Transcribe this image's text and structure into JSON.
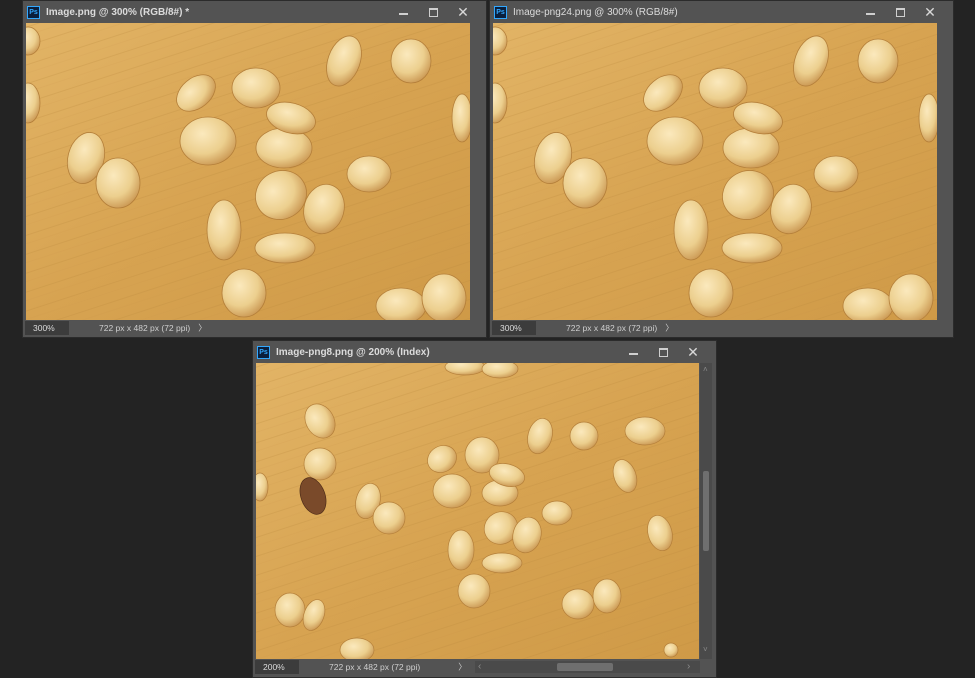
{
  "windows": [
    {
      "title": "Image.png @ 300% (RGB/8#) *",
      "zoom": "300%",
      "doc_info": "722 px x 482 px (72 ppi)",
      "chevron": "〉",
      "app_icon": "Ps"
    },
    {
      "title": "Image-png24.png @ 300% (RGB/8#)",
      "zoom": "300%",
      "doc_info": "722 px x 482 px (72 ppi)",
      "chevron": "〉",
      "app_icon": "Ps"
    },
    {
      "title": "Image-png8.png @ 200% (Index)",
      "zoom": "200%",
      "doc_info": "722 px x 482 px (72 ppi)",
      "chevron": "〉",
      "app_icon": "Ps",
      "scroll_left": "‹",
      "scroll_right": "›",
      "scroll_up": "˄",
      "scroll_down": "˅"
    }
  ],
  "controls": {
    "close_glyph": "✕"
  },
  "colors": {
    "workspace": "#232323",
    "panel": "#535353",
    "wood": "#d9a85a",
    "accent": "#31a8ff"
  },
  "icons": [
    "photoshop-icon",
    "minimize-icon",
    "maximize-icon",
    "close-icon",
    "chevron-right-icon"
  ]
}
